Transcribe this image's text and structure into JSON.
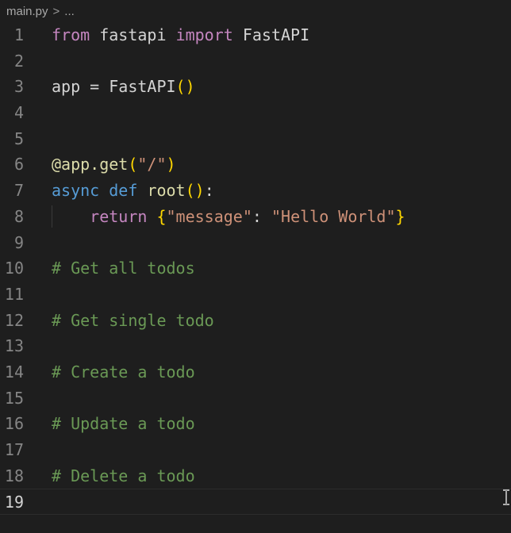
{
  "breadcrumb": {
    "file": "main.py",
    "separator": ">",
    "ellipsis": "..."
  },
  "editor": {
    "current_line": 19,
    "lines": [
      {
        "n": "1",
        "tokens": [
          [
            "from",
            "kw"
          ],
          [
            " fastapi ",
            "plain"
          ],
          [
            "import",
            "kw"
          ],
          [
            " FastAPI",
            "plain"
          ]
        ]
      },
      {
        "n": "2",
        "tokens": []
      },
      {
        "n": "3",
        "tokens": [
          [
            "app = FastAPI",
            "plain"
          ],
          [
            "()",
            "br"
          ]
        ]
      },
      {
        "n": "4",
        "tokens": []
      },
      {
        "n": "5",
        "tokens": []
      },
      {
        "n": "6",
        "tokens": [
          [
            "@app.get",
            "fn"
          ],
          [
            "(",
            "br"
          ],
          [
            "\"/\"",
            "str"
          ],
          [
            ")",
            "br"
          ]
        ]
      },
      {
        "n": "7",
        "tokens": [
          [
            "async",
            "kw2"
          ],
          [
            " ",
            "plain"
          ],
          [
            "def",
            "kw2"
          ],
          [
            " ",
            "plain"
          ],
          [
            "root",
            "fn"
          ],
          [
            "()",
            "br"
          ],
          [
            ":",
            "plain"
          ]
        ]
      },
      {
        "n": "8",
        "indent": true,
        "tokens": [
          [
            "    ",
            "plain"
          ],
          [
            "return",
            "kw"
          ],
          [
            " ",
            "plain"
          ],
          [
            "{",
            "br"
          ],
          [
            "\"message\"",
            "str"
          ],
          [
            ": ",
            "plain"
          ],
          [
            "\"Hello World\"",
            "str"
          ],
          [
            "}",
            "br"
          ]
        ]
      },
      {
        "n": "9",
        "tokens": []
      },
      {
        "n": "10",
        "tokens": [
          [
            "# Get all todos",
            "com"
          ]
        ]
      },
      {
        "n": "11",
        "tokens": []
      },
      {
        "n": "12",
        "tokens": [
          [
            "# Get single todo",
            "com"
          ]
        ]
      },
      {
        "n": "13",
        "tokens": []
      },
      {
        "n": "14",
        "tokens": [
          [
            "# Create a todo",
            "com"
          ]
        ]
      },
      {
        "n": "15",
        "tokens": []
      },
      {
        "n": "16",
        "tokens": [
          [
            "# Update a todo",
            "com"
          ]
        ]
      },
      {
        "n": "17",
        "tokens": []
      },
      {
        "n": "18",
        "tokens": [
          [
            "# Delete a todo",
            "com"
          ]
        ]
      },
      {
        "n": "19",
        "tokens": []
      }
    ]
  },
  "colors": {
    "background": "#1e1e1e",
    "keyword_control": "#c586c0",
    "keyword_storage": "#569cd6",
    "function": "#dcdcaa",
    "string": "#ce9178",
    "comment": "#6a9955",
    "bracket": "#ffd700",
    "plain": "#d4d4d4"
  },
  "icons": {
    "mouse_cursor": "text-cursor-icon"
  }
}
